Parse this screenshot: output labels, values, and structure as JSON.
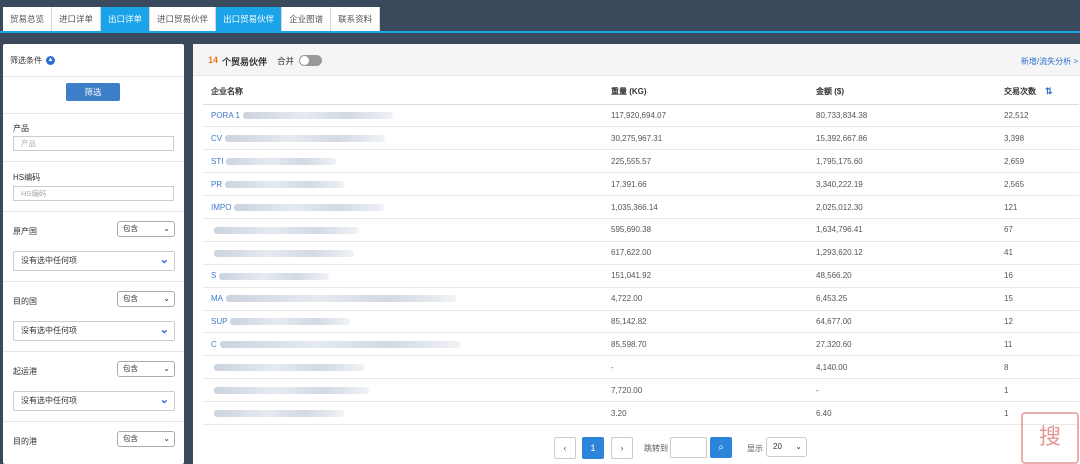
{
  "tabs": [
    {
      "label": "贸易总览",
      "active": false
    },
    {
      "label": "进口详单",
      "active": false
    },
    {
      "label": "出口详单",
      "active": true
    },
    {
      "label": "进口贸易伙伴",
      "active": false
    },
    {
      "label": "出口贸易伙伴",
      "active": true
    },
    {
      "label": "企业图谱",
      "active": false
    },
    {
      "label": "联系资料",
      "active": false
    }
  ],
  "sidebar": {
    "title": "筛选条件",
    "filter_button": "筛选",
    "product": {
      "label": "产品",
      "placeholder": "产品"
    },
    "hs": {
      "label": "HS编码",
      "placeholder": "HS编码"
    },
    "origin": {
      "label": "原产国",
      "mode": "包含",
      "value": "没有选中任何项"
    },
    "destination": {
      "label": "目的国",
      "mode": "包含",
      "value": "没有选中任何项"
    },
    "departure_port": {
      "label": "起运港",
      "mode": "包含",
      "value": "没有选中任何项"
    },
    "arrival_port": {
      "label": "目的港",
      "mode": "包含"
    }
  },
  "main": {
    "count": "14",
    "count_label": "个贸易伙伴",
    "merge_label": "合并",
    "merge_on": false,
    "analysis_link": "新增/流失分析 >"
  },
  "table": {
    "headers": [
      "企业名称",
      "重量 (KG)",
      "金额 ($)",
      "交易次数"
    ],
    "rows": [
      {
        "name": "PORA 1",
        "weight": "117,920,694.07",
        "amount": "80,733,834.38",
        "count": "22,512"
      },
      {
        "name": "CV",
        "weight": "30,275,967.31",
        "amount": "15,392,667.86",
        "count": "3,398"
      },
      {
        "name": "STI",
        "weight": "225,555.57",
        "amount": "1,795,175.60",
        "count": "2,659"
      },
      {
        "name": "PR",
        "weight": "17,391.66",
        "amount": "3,340,222.19",
        "count": "2,565"
      },
      {
        "name": "IMPO",
        "weight": "1,035,366.14",
        "amount": "2,025,012.30",
        "count": "121"
      },
      {
        "name": "",
        "weight": "595,690.38",
        "amount": "1,634,796.41",
        "count": "67"
      },
      {
        "name": "",
        "weight": "617,622.00",
        "amount": "1,293,620.12",
        "count": "41"
      },
      {
        "name": "S",
        "weight": "151,041.92",
        "amount": "48,566.20",
        "count": "16"
      },
      {
        "name": "MA",
        "weight": "4,722.00",
        "amount": "6,453.25",
        "count": "15"
      },
      {
        "name": "SUP",
        "weight": "85,142.82",
        "amount": "64,677.00",
        "count": "12"
      },
      {
        "name": "C",
        "weight": "85,598.70",
        "amount": "27,320.60",
        "count": "11"
      },
      {
        "name": "",
        "weight": "-",
        "amount": "4,140.00",
        "count": "8"
      },
      {
        "name": "",
        "weight": "7,720.00",
        "amount": "-",
        "count": "1"
      },
      {
        "name": "",
        "weight": "3.20",
        "amount": "6.40",
        "count": "1"
      }
    ]
  },
  "pagination": {
    "prev": "‹",
    "current": "1",
    "next": "›",
    "jump_label": "跳转到",
    "show_label": "显示",
    "page_size": "20"
  },
  "watermark": "搜"
}
